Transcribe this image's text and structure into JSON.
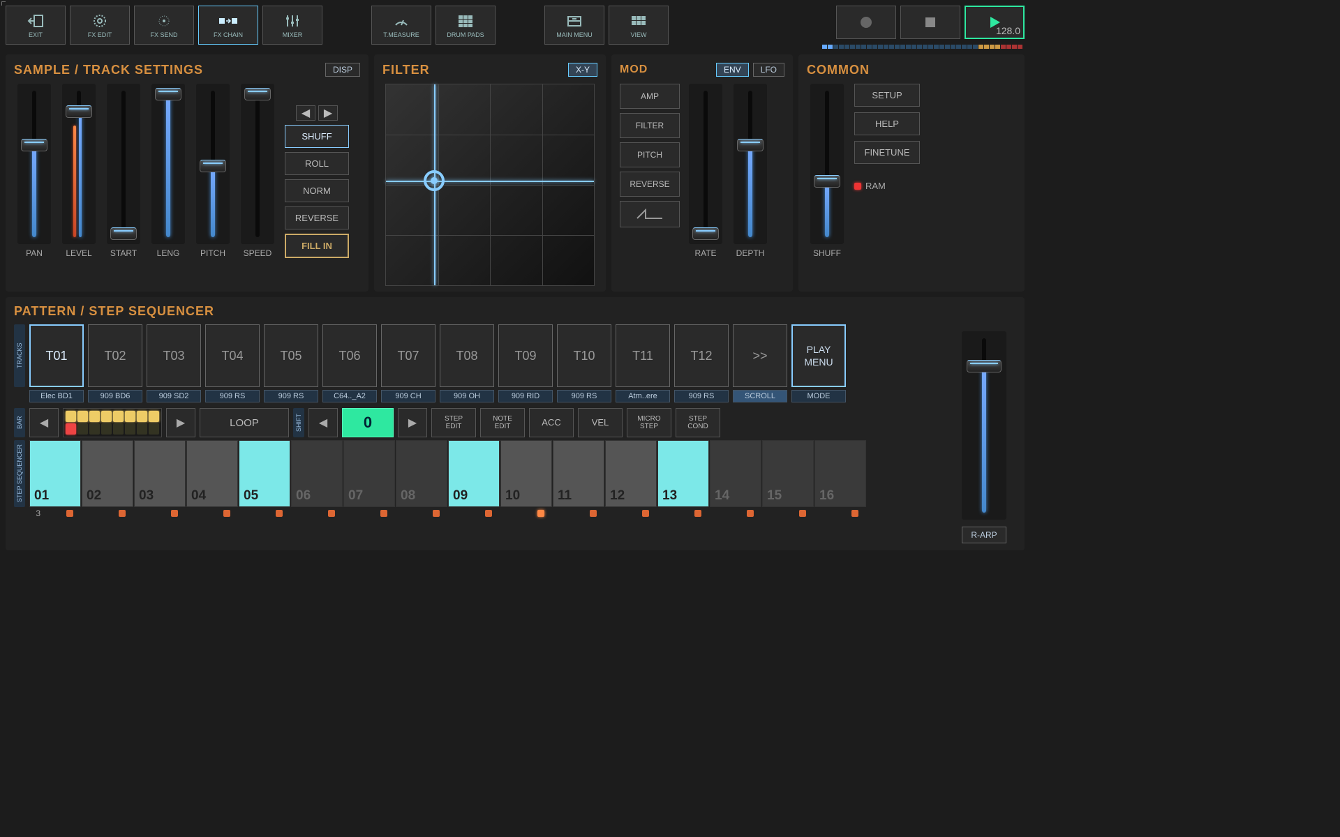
{
  "toolbar": {
    "exit": "EXIT",
    "fx_edit": "FX EDIT",
    "fx_send": "FX SEND",
    "fx_chain": "FX CHAIN",
    "mixer": "MIXER",
    "tmeasure": "T.MEASURE",
    "drum_pads": "DRUM PADS",
    "main_menu": "MAIN MENU",
    "view": "VIEW",
    "tempo": "128.0"
  },
  "sample": {
    "title": "SAMPLE / TRACK SETTINGS",
    "disp": "DISP",
    "sliders": [
      "PAN",
      "LEVEL",
      "START",
      "LENG",
      "PITCH",
      "SPEED"
    ],
    "shuff": "SHUFF",
    "roll": "ROLL",
    "norm": "NORM",
    "reverse": "REVERSE",
    "fillin": "FILL IN"
  },
  "filter": {
    "title": "FILTER",
    "xy": "X-Y"
  },
  "mod": {
    "title": "MOD",
    "env": "ENV",
    "lfo": "LFO",
    "amp": "AMP",
    "filter": "FILTER",
    "pitch": "PITCH",
    "reverse": "REVERSE",
    "rate": "RATE",
    "depth": "DEPTH"
  },
  "common": {
    "title": "COMMON",
    "setup": "SETUP",
    "help": "HELP",
    "finetune": "FINETUNE",
    "ram": "RAM",
    "shuff": "SHUFF"
  },
  "seq": {
    "title": "PATTERN / STEP SEQUENCER",
    "tracks_label": "TRACKS",
    "tracks": [
      "T01",
      "T02",
      "T03",
      "T04",
      "T05",
      "T06",
      "T07",
      "T08",
      "T09",
      "T10",
      "T11",
      "T12"
    ],
    "more": ">>",
    "play_menu1": "PLAY",
    "play_menu2": "MENU",
    "track_names": [
      "Elec BD1",
      "909 BD6",
      "909 SD2",
      "909 RS",
      "909 RS",
      "C64.._A2",
      "909 CH",
      "909 OH",
      "909 RID",
      "909 RS",
      "Atm..ere",
      "909 RS"
    ],
    "scroll": "SCROLL",
    "mode": "MODE",
    "bar": "BAR",
    "shift": "SHIFT",
    "loop": "LOOP",
    "shift_val": "0",
    "step_edit1": "STEP",
    "step_edit2": "EDIT",
    "note_edit1": "NOTE",
    "note_edit2": "EDIT",
    "acc": "ACC",
    "vel": "VEL",
    "micro1": "MICRO",
    "micro2": "STEP",
    "cond1": "STEP",
    "cond2": "COND",
    "steps": [
      "01",
      "02",
      "03",
      "04",
      "05",
      "06",
      "07",
      "08",
      "09",
      "10",
      "11",
      "12",
      "13",
      "14",
      "15",
      "16"
    ],
    "row_num": "3",
    "step_seq_label": "STEP SEQUENCER",
    "rarp": "R-ARP"
  }
}
